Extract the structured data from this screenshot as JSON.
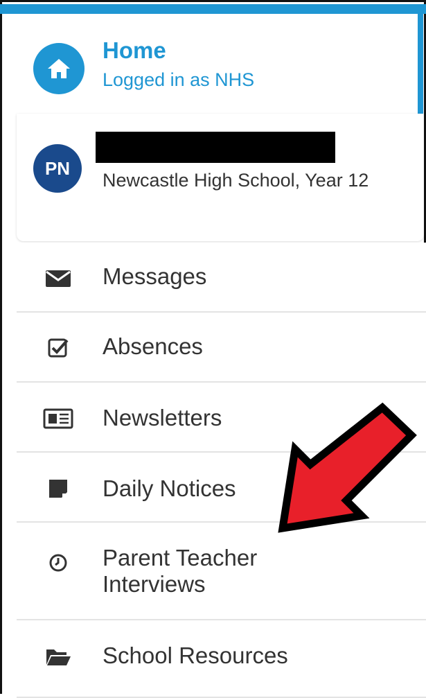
{
  "home": {
    "title": "Home",
    "subtitle": "Logged in as NHS"
  },
  "profile": {
    "initials": "PN",
    "school": "Newcastle High School, Year 12"
  },
  "menu": [
    {
      "label": "Messages",
      "icon": "envelope-icon"
    },
    {
      "label": "Absences",
      "icon": "checkbox-icon"
    },
    {
      "label": "Newsletters",
      "icon": "newspaper-icon"
    },
    {
      "label": "Daily Notices",
      "icon": "sticky-note-icon"
    },
    {
      "label": "Parent Teacher Interviews",
      "icon": "clock-icon"
    },
    {
      "label": "School Resources",
      "icon": "folder-icon"
    }
  ],
  "colors": {
    "accent": "#1f96d3",
    "avatar": "#1a4a8c",
    "arrow": "#e8202a"
  }
}
